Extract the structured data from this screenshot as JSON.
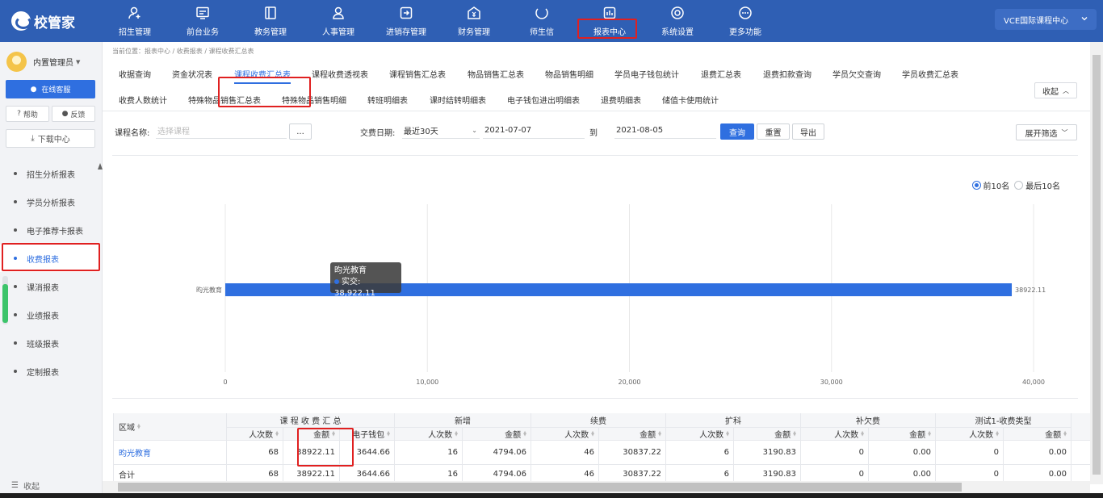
{
  "header": {
    "logo": "校管家",
    "nav": [
      {
        "label": "招生管理",
        "icon": "user-plus-icon"
      },
      {
        "label": "前台业务",
        "icon": "monitor-icon"
      },
      {
        "label": "教务管理",
        "icon": "book-icon"
      },
      {
        "label": "人事管理",
        "icon": "person-icon"
      },
      {
        "label": "进销存管理",
        "icon": "inventory-icon"
      },
      {
        "label": "财务管理",
        "icon": "finance-icon"
      },
      {
        "label": "师生信",
        "icon": "message-icon"
      },
      {
        "label": "报表中心",
        "icon": "report-icon"
      },
      {
        "label": "系统设置",
        "icon": "settings-icon"
      },
      {
        "label": "更多功能",
        "icon": "more-icon"
      }
    ],
    "campus": "VCE国际课程中心"
  },
  "sidebar": {
    "user": "内置管理员",
    "online_service": "在线客服",
    "help": "帮助",
    "feedback": "反馈",
    "download": "下载中心",
    "items": [
      {
        "label": "招生分析报表"
      },
      {
        "label": "学员分析报表"
      },
      {
        "label": "电子推荐卡报表"
      },
      {
        "label": "收费报表"
      },
      {
        "label": "课消报表"
      },
      {
        "label": "业绩报表"
      },
      {
        "label": "班级报表"
      },
      {
        "label": "定制报表"
      }
    ],
    "collapse": "收起"
  },
  "breadcrumb": "当前位置：报表中心 / 收费报表 / 课程收费汇总表",
  "tabs": {
    "row1": [
      "收据查询",
      "资金状况表",
      "课程收费汇总表",
      "课程收费透视表",
      "课程销售汇总表",
      "物品销售汇总表",
      "物品销售明细",
      "学员电子钱包统计",
      "退费汇总表",
      "退费扣款查询",
      "学员欠交查询",
      "学员收费汇总表"
    ],
    "row2": [
      "收费人数统计",
      "特殊物品销售汇总表",
      "特殊物品销售明细",
      "转班明细表",
      "课时结转明细表",
      "电子钱包进出明细表",
      "退费明细表",
      "储值卡使用统计"
    ],
    "collapse": "收起"
  },
  "filters": {
    "course_label": "课程名称:",
    "course_placeholder": "选择课程",
    "browse": "...",
    "date_label": "交费日期:",
    "range": "最近30天",
    "start": "2021-07-07",
    "to": "到",
    "end": "2021-08-05",
    "query": "查询",
    "reset": "重置",
    "export": "导出",
    "expand": "展开筛选"
  },
  "chart_legend": {
    "top": "前10名",
    "bottom": "最后10名"
  },
  "chart_data": {
    "type": "bar",
    "orientation": "horizontal",
    "categories": [
      "昀光教育"
    ],
    "series": [
      {
        "name": "实交",
        "values": [
          38922.11
        ]
      }
    ],
    "xlim": [
      0,
      40000
    ],
    "xticks": [
      "0",
      "10,000",
      "20,000",
      "30,000",
      "40,000"
    ],
    "data_labels": [
      "38922.11"
    ],
    "tooltip": {
      "title": "昀光教育",
      "text": "实交: 38,922.11"
    },
    "grid": true,
    "legend": "top-right"
  },
  "table": {
    "region": "区域",
    "groups": [
      "课 程 收 费 汇 总",
      "新增",
      "续费",
      "扩科",
      "补欠费",
      "测试1-收费类型"
    ],
    "sub": {
      "count": "人次数",
      "amount": "金额",
      "wallet": "电子钱包"
    },
    "rows": [
      {
        "name": "昀光教育",
        "vals": [
          "68",
          "38922.11",
          "3644.66",
          "16",
          "4794.06",
          "46",
          "30837.22",
          "6",
          "3190.83",
          "0",
          "0.00",
          "0",
          "0.00"
        ]
      },
      {
        "name": "合计",
        "vals": [
          "68",
          "38922.11",
          "3644.66",
          "16",
          "4794.06",
          "46",
          "30837.22",
          "6",
          "3190.83",
          "0",
          "0.00",
          "0",
          "0.00"
        ]
      }
    ]
  },
  "colors": {
    "header": "#2f5fb4",
    "accent": "#2f6fe0",
    "highlight": "#e02020"
  }
}
